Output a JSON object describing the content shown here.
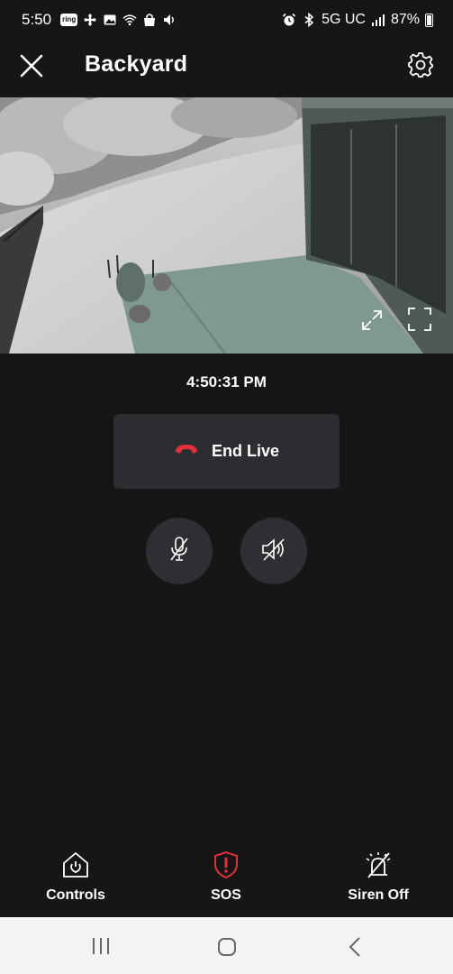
{
  "status_bar": {
    "time": "5:50",
    "ring_badge": "ring",
    "network": "5G UC",
    "battery": "87%",
    "icons": [
      "ring-icon",
      "fan-icon",
      "gallery-icon",
      "wifi-icon",
      "bag-icon",
      "volume-icon",
      "alarm-icon",
      "bluetooth-icon",
      "signal-icon",
      "battery-icon"
    ]
  },
  "header": {
    "title": "Backyard",
    "close_icon": "close-icon",
    "settings_icon": "gear-icon"
  },
  "video": {
    "expand_icon": "expand-diagonal-icon",
    "fullscreen_icon": "fullscreen-icon"
  },
  "timestamp": "4:50:31 PM",
  "end_live": {
    "label": "End Live",
    "icon": "hang-up-phone-icon",
    "icon_color": "#e0303a"
  },
  "controls": {
    "mic_icon": "mic-muted-icon",
    "speaker_icon": "speaker-muted-icon"
  },
  "bottom_actions": {
    "controls_label": "Controls",
    "sos_label": "SOS",
    "siren_label": "Siren Off",
    "sos_color": "#e0303a"
  },
  "nav_bar": {
    "recents_icon": "recents-icon",
    "home_icon": "home-icon",
    "back_icon": "back-icon"
  }
}
